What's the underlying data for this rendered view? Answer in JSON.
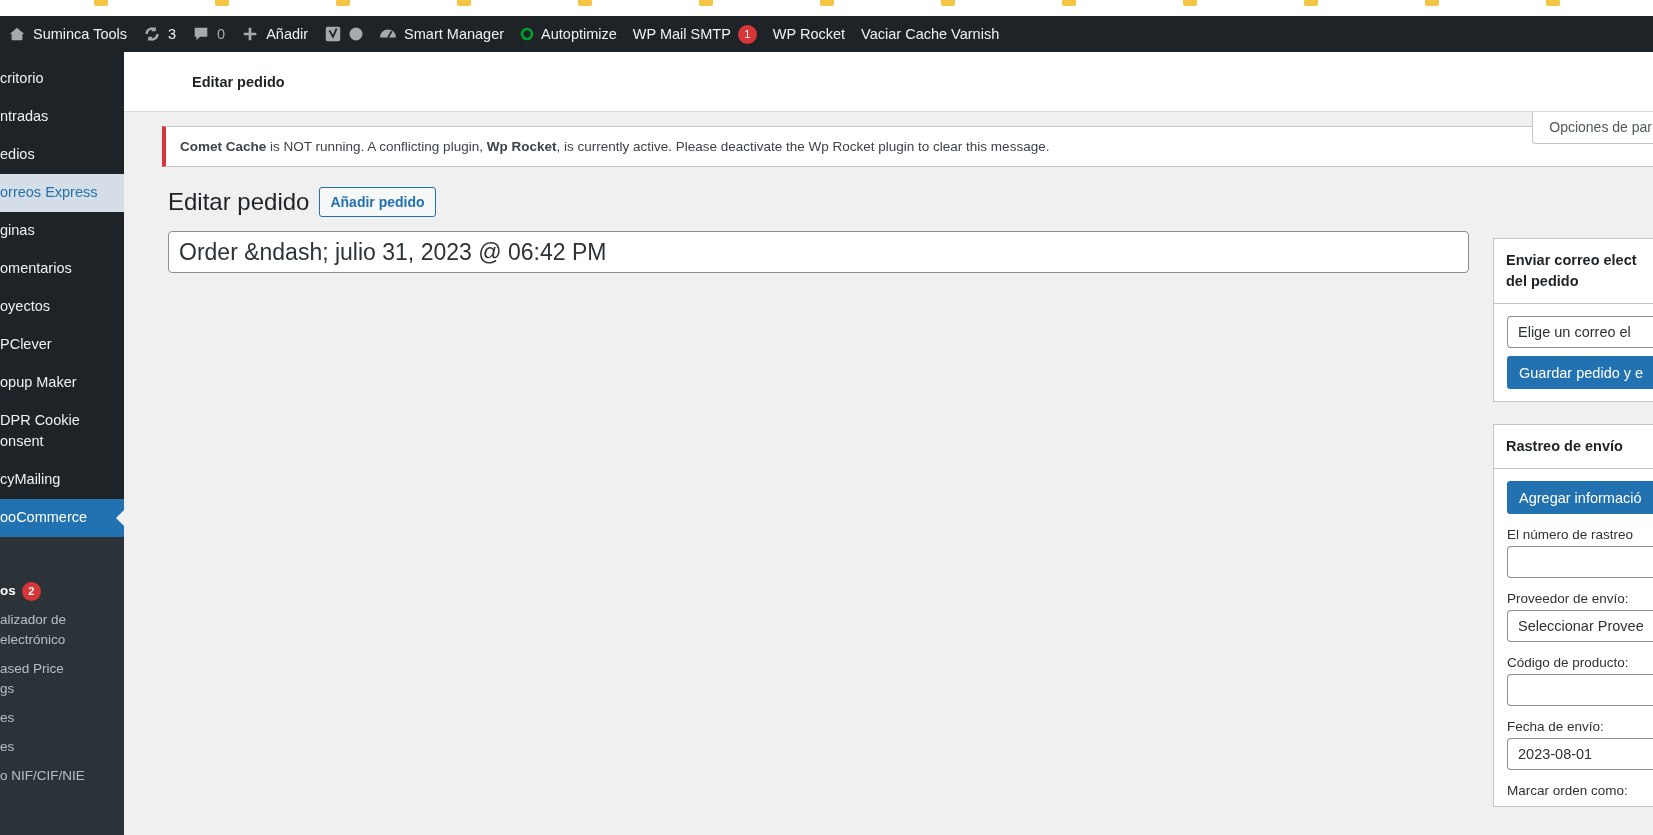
{
  "admin_bar": {
    "site": "Suminca Tools",
    "updates": "3",
    "comments": "0",
    "new": "Añadir",
    "items": [
      {
        "kind": "gauge",
        "label": "Smart Manager"
      },
      {
        "kind": "ring",
        "label": "Autoptimize"
      },
      {
        "kind": "plain",
        "label": "WP Mail SMTP",
        "badge": "1"
      },
      {
        "kind": "plain",
        "label": "WP Rocket"
      },
      {
        "kind": "plain",
        "label": "Vaciar Cache Varnish"
      }
    ]
  },
  "sidebar": {
    "items": [
      {
        "label": "critorio",
        "selected": false,
        "highlighted": false
      },
      {
        "label": "ntradas",
        "selected": false,
        "highlighted": false
      },
      {
        "label": "edios",
        "selected": false,
        "highlighted": false
      },
      {
        "label": "orreos Express",
        "selected": false,
        "highlighted": true
      },
      {
        "label": "ginas",
        "selected": false,
        "highlighted": false
      },
      {
        "label": "omentarios",
        "selected": false,
        "highlighted": false
      },
      {
        "label": "oyectos",
        "selected": false,
        "highlighted": false
      },
      {
        "label": "PClever",
        "selected": false,
        "highlighted": false
      },
      {
        "label": "opup Maker",
        "selected": false,
        "highlighted": false
      },
      {
        "label": "DPR Cookie\nonsent",
        "selected": false,
        "highlighted": false
      },
      {
        "label": "cyMailing",
        "selected": false,
        "highlighted": false
      },
      {
        "label": "ooCommerce",
        "selected": true,
        "highlighted": false
      }
    ],
    "submenu": [
      {
        "label": "os",
        "badge": "2",
        "selected": true
      },
      {
        "label": "alizador de\n electrónico",
        "selected": false
      },
      {
        "label": "ased Price\ngs",
        "selected": false
      },
      {
        "label": "es",
        "selected": false
      },
      {
        "label": "es",
        "selected": false
      },
      {
        "label": "o NIF/CIF/NIE",
        "selected": false
      }
    ]
  },
  "header": {
    "title": "Editar pedido"
  },
  "screen_options": "Opciones de par",
  "notice": "**Comet Cache** is NOT running. A conflicting plugin, **Wp Rocket**, is currently active. Please deactivate the Wp Rocket plugin to clear this message.",
  "page": {
    "title": "Editar pedido",
    "add_button": "Añadir pedido",
    "order_title": "Order &ndash; julio 31, 2023 @ 06:42 PM"
  },
  "email_box": {
    "title": "Enviar correo elect\ndel pedido",
    "select": "Elige un correo el",
    "button": "Guardar pedido y e"
  },
  "tracking_box": {
    "title": "Rastreo de envío",
    "button": "Agregar informació",
    "fields": [
      {
        "kind": "input",
        "label": "El número de rastreo"
      },
      {
        "kind": "select",
        "label": "Proveedor de envío:",
        "value": "Seleccionar Provee"
      },
      {
        "kind": "input",
        "label": "Código de producto:"
      },
      {
        "kind": "input",
        "label": "Fecha de envío:",
        "value": "2023-08-01"
      },
      {
        "kind": "label",
        "label": "Marcar orden como:"
      }
    ]
  }
}
